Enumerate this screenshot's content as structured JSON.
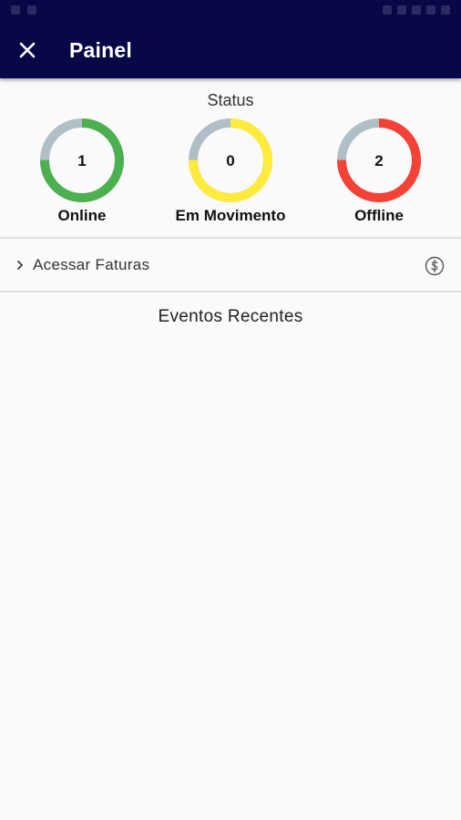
{
  "appbar": {
    "title": "Painel",
    "close_icon": "close-icon",
    "background": "#070845"
  },
  "status": {
    "title": "Status",
    "gauges": [
      {
        "label": "Online",
        "value": "1",
        "color": "#4caf50",
        "fraction": 0.75
      },
      {
        "label": "Em Movimento",
        "value": "0",
        "color": "#ffeb3b",
        "fraction": 0.75
      },
      {
        "label": "Offline",
        "value": "2",
        "color": "#f44336",
        "fraction": 0.75
      }
    ],
    "track_color": "#b0bec5"
  },
  "faturas": {
    "label": "Acessar Faturas",
    "chevron_icon": "chevron-right-icon",
    "icon": "dollar-icon"
  },
  "eventos": {
    "title": "Eventos Recentes"
  }
}
